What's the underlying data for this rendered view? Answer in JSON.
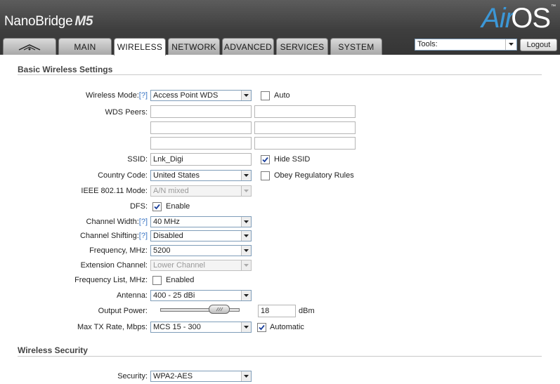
{
  "header": {
    "brand_name": "NanoBridge",
    "brand_model": "M5",
    "product_air": "Air",
    "product_os": "OS",
    "trademark": "™"
  },
  "tabs": [
    {
      "label": "MAIN"
    },
    {
      "label": "WIRELESS"
    },
    {
      "label": "NETWORK"
    },
    {
      "label": "ADVANCED"
    },
    {
      "label": "SERVICES"
    },
    {
      "label": "SYSTEM"
    }
  ],
  "tools": {
    "selected": "Tools:",
    "logout_label": "Logout"
  },
  "basic": {
    "heading": "Basic Wireless Settings",
    "help_marker": "[?]",
    "wireless_mode_label": "Wireless Mode:",
    "wireless_mode_value": "Access Point WDS",
    "auto_label": "Auto",
    "auto_checked": false,
    "wds_peers_label": "WDS Peers:",
    "wds_peers": [
      "",
      "",
      "",
      "",
      "",
      ""
    ],
    "ssid_label": "SSID:",
    "ssid_value": "Lnk_Digi",
    "hide_ssid_label": "Hide SSID",
    "hide_ssid_checked": true,
    "country_label": "Country Code:",
    "country_value": "United States",
    "obey_label": "Obey Regulatory Rules",
    "obey_checked": false,
    "ieee_label": "IEEE 802.11 Mode:",
    "ieee_value": "A/N mixed",
    "dfs_label": "DFS:",
    "dfs_enable_label": "Enable",
    "dfs_checked": true,
    "channel_width_label": "Channel Width:",
    "channel_width_value": "40 MHz",
    "channel_shifting_label": "Channel Shifting:",
    "channel_shifting_value": "Disabled",
    "frequency_label": "Frequency, MHz:",
    "frequency_value": "5200",
    "extension_label": "Extension Channel:",
    "extension_value": "Lower Channel",
    "freq_list_label": "Frequency List, MHz:",
    "freq_list_enabled_label": "Enabled",
    "freq_list_checked": false,
    "antenna_label": "Antenna:",
    "antenna_value": "400 - 25 dBi",
    "output_power_label": "Output Power:",
    "output_power_value": "18",
    "output_power_unit": "dBm",
    "max_tx_label": "Max TX Rate, Mbps:",
    "max_tx_value": "MCS 15 - 300",
    "automatic_label": "Automatic",
    "automatic_checked": true
  },
  "security": {
    "heading": "Wireless Security",
    "security_label": "Security:",
    "security_value": "WPA2-AES"
  }
}
